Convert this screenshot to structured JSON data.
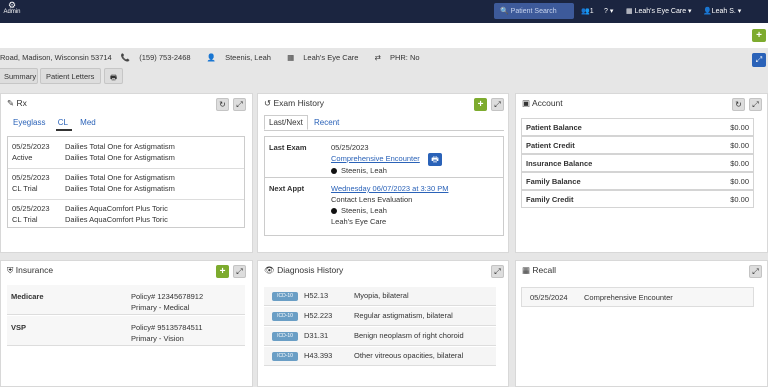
{
  "topbar": {
    "logo": "Admin",
    "search_placeholder": "Patient Search",
    "user_count": "1",
    "help": "?",
    "location": "Leah's Eye Care",
    "user": "Leah S."
  },
  "patient_info": {
    "address": "Road, Madison, Wisconsin 53714",
    "phone": "(159) 753-2468",
    "provider": "Steenis, Leah",
    "location": "Leah's Eye Care",
    "phr": "PHR: No"
  },
  "nav": {
    "summary": "Summary",
    "patient_letters": "Patient Letters"
  },
  "rx": {
    "title": "Rx",
    "tabs": [
      "Eyeglass",
      "CL",
      "Med"
    ],
    "rows": [
      {
        "date": "05/25/2023",
        "status": "Active",
        "desc": "Dailies Total One for Astigmatism",
        "desc2": "Dailies Total One for Astigmatism"
      },
      {
        "date": "05/25/2023",
        "status": "CL Trial",
        "desc": "Dailies Total One for Astigmatism",
        "desc2": "Dailies Total One for Astigmatism"
      },
      {
        "date": "05/25/2023",
        "status": "CL Trial",
        "desc": "Dailies AquaComfort Plus Toric",
        "desc2": "Dailies AquaComfort Plus Toric"
      }
    ]
  },
  "exam": {
    "title": "Exam History",
    "tabs": [
      "Last/Next",
      "Recent"
    ],
    "last_label": "Last Exam",
    "last_date": "05/25/2023",
    "last_type": "Comprehensive Encounter",
    "last_provider": "Steenis, Leah",
    "next_label": "Next Appt",
    "next_date": "Wednesday 06/07/2023 at 3:30 PM",
    "next_type": "Contact Lens Evaluation",
    "next_provider": "Steenis, Leah",
    "next_location": "Leah's Eye Care"
  },
  "account": {
    "title": "Account",
    "rows": [
      {
        "label": "Patient Balance",
        "value": "$0.00"
      },
      {
        "label": "Patient Credit",
        "value": "$0.00"
      },
      {
        "label": "Insurance Balance",
        "value": "$0.00"
      },
      {
        "label": "Family Balance",
        "value": "$0.00"
      },
      {
        "label": "Family Credit",
        "value": "$0.00"
      }
    ]
  },
  "insurance": {
    "title": "Insurance",
    "rows": [
      {
        "name": "Medicare",
        "policy": "Policy# 12345678912",
        "type": "Primary - Medical"
      },
      {
        "name": "VSP",
        "policy": "Policy# 95135784511",
        "type": "Primary - Vision"
      }
    ]
  },
  "diagnosis": {
    "title": "Diagnosis History",
    "rows": [
      {
        "badge": "ICD-10",
        "code": "H52.13",
        "desc": "Myopia, bilateral"
      },
      {
        "badge": "ICD-10",
        "code": "H52.223",
        "desc": "Regular astigmatism, bilateral"
      },
      {
        "badge": "ICD-10",
        "code": "D31.31",
        "desc": "Benign neoplasm of right choroid"
      },
      {
        "badge": "ICD-10",
        "code": "H43.393",
        "desc": "Other vitreous opacities, bilateral"
      }
    ]
  },
  "recall": {
    "title": "Recall",
    "date": "05/25/2024",
    "type": "Comprehensive Encounter"
  }
}
